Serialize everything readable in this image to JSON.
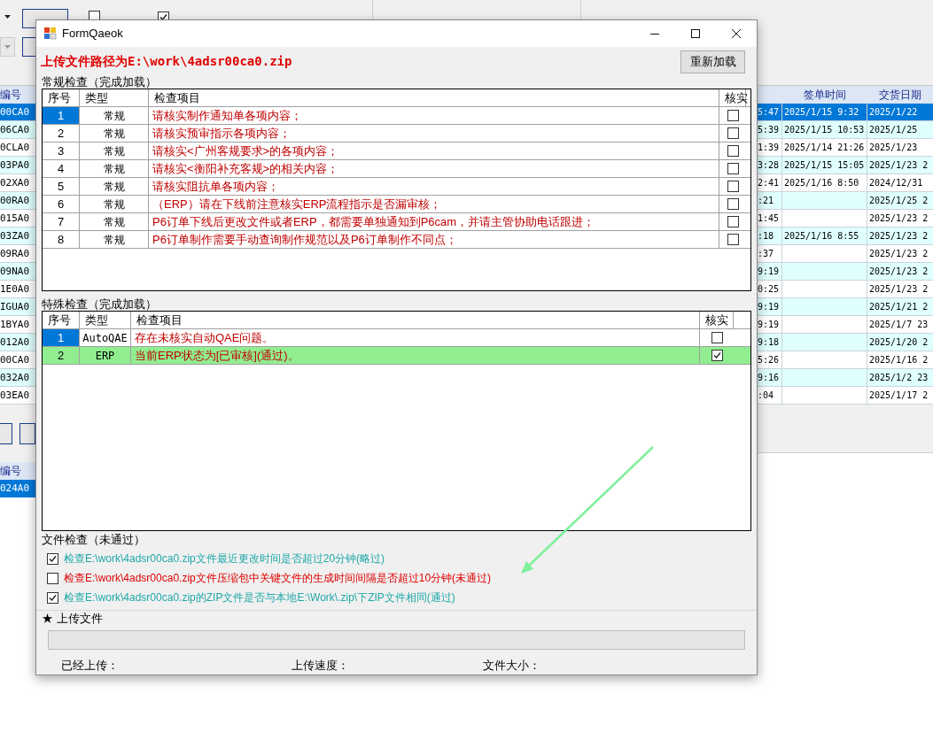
{
  "background": {
    "toolbar": {
      "checkboxes": [
        {
          "checked": false
        },
        {
          "checked": true
        }
      ]
    },
    "left_table": {
      "header": "编号",
      "rows": [
        {
          "text": "00CA0",
          "selected": true
        },
        {
          "text": "06CA0",
          "selected": false
        },
        {
          "text": "0CLA0",
          "selected": false
        },
        {
          "text": "03PA0",
          "selected": false
        },
        {
          "text": "02XA0",
          "selected": false
        },
        {
          "text": "00RA0",
          "selected": false
        },
        {
          "text": "015A0",
          "selected": false
        },
        {
          "text": "03ZA0",
          "selected": false
        },
        {
          "text": "09RA0",
          "selected": false
        },
        {
          "text": "09NA0",
          "selected": false
        },
        {
          "text": "1E0A0",
          "selected": false
        },
        {
          "text": "IGUA0",
          "selected": false
        },
        {
          "text": "1BYA0",
          "selected": false
        },
        {
          "text": "012A0",
          "selected": false
        },
        {
          "text": "00CA0",
          "selected": false
        },
        {
          "text": "032A0",
          "selected": false
        },
        {
          "text": "03EA0",
          "selected": false
        }
      ]
    },
    "lower_table": {
      "header": "编号",
      "rows": [
        {
          "text": "024A0",
          "selected": true
        }
      ]
    },
    "right_table": {
      "columns": [
        "签单时间",
        "交货日期"
      ],
      "rows": [
        {
          "column_1": "5:47",
          "sign_time": "2025/1/15 9:32",
          "delivery": "2025/1/22",
          "selected": true
        },
        {
          "column_1": "5:39",
          "sign_time": "2025/1/15 10:53",
          "delivery": "2025/1/25",
          "selected": false
        },
        {
          "column_1": "1:39",
          "sign_time": "2025/1/14 21:26",
          "delivery": "2025/1/23",
          "selected": false
        },
        {
          "column_1": "3:28",
          "sign_time": "2025/1/15 15:05",
          "delivery": "2025/1/23 2",
          "selected": false
        },
        {
          "column_1": "2:41",
          "sign_time": "2025/1/16 8:50",
          "delivery": "2024/12/31",
          "selected": false
        },
        {
          "column_1": ":21",
          "sign_time": "",
          "delivery": "2025/1/25 2",
          "selected": false
        },
        {
          "column_1": "1:45",
          "sign_time": "",
          "delivery": "2025/1/23 2",
          "selected": false
        },
        {
          "column_1": ":18",
          "sign_time": "2025/1/16 8:55",
          "delivery": "2025/1/23 2",
          "selected": false
        },
        {
          "column_1": ":37",
          "sign_time": "",
          "delivery": "2025/1/23 2",
          "selected": false
        },
        {
          "column_1": "9:19",
          "sign_time": "",
          "delivery": "2025/1/23 2",
          "selected": false
        },
        {
          "column_1": "0:25",
          "sign_time": "",
          "delivery": "2025/1/23 2",
          "selected": false
        },
        {
          "column_1": "9:19",
          "sign_time": "",
          "delivery": "2025/1/21 2",
          "selected": false
        },
        {
          "column_1": "9:19",
          "sign_time": "",
          "delivery": "2025/1/7 23",
          "selected": false
        },
        {
          "column_1": "9:18",
          "sign_time": "",
          "delivery": "2025/1/20 2",
          "selected": false
        },
        {
          "column_1": "5:26",
          "sign_time": "",
          "delivery": "2025/1/16 2",
          "selected": false
        },
        {
          "column_1": "9:16",
          "sign_time": "",
          "delivery": "2025/1/2 23",
          "selected": false
        },
        {
          "column_1": ":04",
          "sign_time": "",
          "delivery": "2025/1/17 2",
          "selected": false
        }
      ]
    }
  },
  "dialog": {
    "title": "FormQaeok",
    "path_label": "上传文件路径为E:\\work\\4adsr00ca0.zip",
    "reload_button": "重新加载",
    "regular_check": {
      "title": "常规检查（完成加载）",
      "columns": [
        "序号",
        "类型",
        "检查项目",
        "核实"
      ],
      "rows": [
        {
          "index": "1",
          "type": "常规",
          "item": "请核实制作通知单各项内容；",
          "checked": false,
          "selected": true,
          "highlighted": false
        },
        {
          "index": "2",
          "type": "常规",
          "item": "请核实预审指示各项内容；",
          "checked": false,
          "selected": false,
          "highlighted": false
        },
        {
          "index": "3",
          "type": "常规",
          "item": "请核实<广州客规要求>的各项内容；",
          "checked": false,
          "selected": false,
          "highlighted": false
        },
        {
          "index": "4",
          "type": "常规",
          "item": "请核实<衡阳补充客规>的相关内容；",
          "checked": false,
          "selected": false,
          "highlighted": false
        },
        {
          "index": "5",
          "type": "常规",
          "item": "请核实阻抗单各项内容；",
          "checked": false,
          "selected": false,
          "highlighted": false
        },
        {
          "index": "6",
          "type": "常规",
          "item": "（ERP）请在下线前注意核实ERP流程指示是否漏审核；",
          "checked": false,
          "selected": false,
          "highlighted": false
        },
        {
          "index": "7",
          "type": "常规",
          "item": "P6订单下线后更改文件或者ERP，都需要单独通知到P6cam，并请主管协助电话跟进；",
          "checked": false,
          "selected": false,
          "highlighted": false
        },
        {
          "index": "8",
          "type": "常规",
          "item": "P6订单制作需要手动查询制作规范以及P6订单制作不同点；",
          "checked": false,
          "selected": false,
          "highlighted": false
        }
      ]
    },
    "special_check": {
      "title": "特殊检查（完成加载）",
      "columns": [
        "序号",
        "类型",
        "检查项目",
        "核实"
      ],
      "rows": [
        {
          "index": "1",
          "type": "AutoQAE",
          "item": "存在未核实自动QAE问题。",
          "checked": false,
          "selected": true,
          "highlighted": false
        },
        {
          "index": "2",
          "type": "ERP",
          "item": "当前ERP状态为[已审核](通过)。",
          "checked": true,
          "selected": false,
          "highlighted": true
        }
      ]
    },
    "file_check": {
      "title": "文件检查（未通过）",
      "items": [
        {
          "text": "检查E:\\work\\4adsr00ca0.zip文件最近更改时间是否超过20分钟(略过)",
          "checked": true,
          "kind": "pass"
        },
        {
          "text": "检查E:\\work\\4adsr00ca0.zip文件压缩包中关键文件的生成时间间隔是否超过10分钟(未通过)",
          "checked": false,
          "kind": "fail"
        },
        {
          "text": "检查E:\\work\\4adsr00ca0.zip的ZIP文件是否与本地E:\\Work\\.zip\\下ZIP文件相同(通过)",
          "checked": true,
          "kind": "pass"
        }
      ]
    },
    "upload": {
      "title": "★ 上传文件",
      "level": 0,
      "labels": [
        "已经上传：",
        "上传速度：",
        "文件大小："
      ]
    }
  }
}
